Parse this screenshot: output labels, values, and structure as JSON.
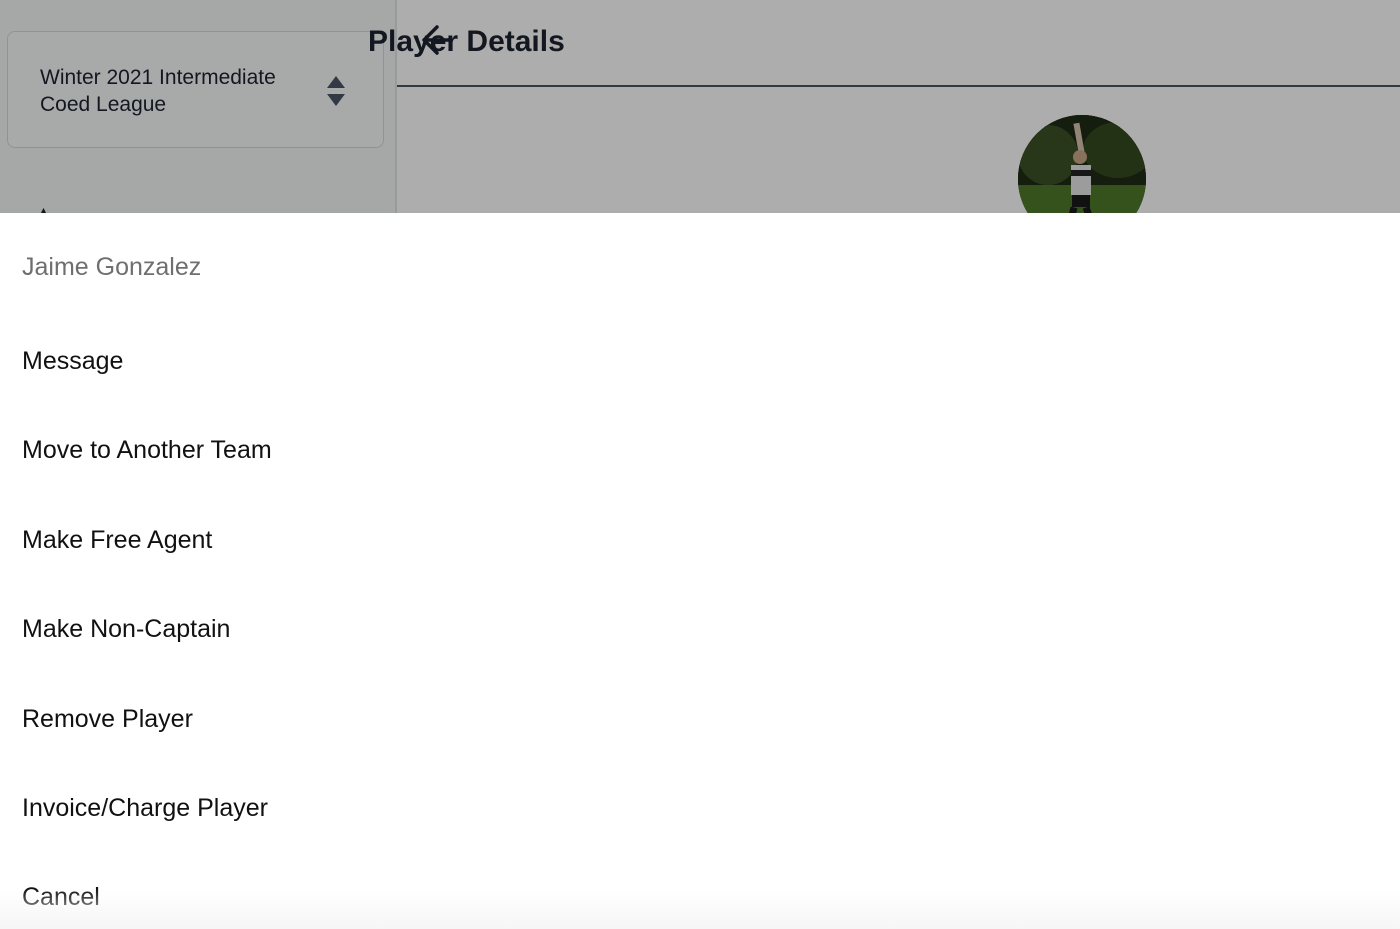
{
  "sidebar": {
    "league_select": {
      "label": "Winter 2021 Intermediate Coed League",
      "icon": "sort-updown-icon"
    }
  },
  "header": {
    "back_icon": "arrow-left-icon",
    "title": "Player Details"
  },
  "avatar": {
    "icon": "player-photo"
  },
  "action_sheet": {
    "header": "Jaime Gonzalez",
    "items": [
      {
        "label": "Message"
      },
      {
        "label": "Move to Another Team"
      },
      {
        "label": "Make Free Agent"
      },
      {
        "label": "Make Non-Captain"
      },
      {
        "label": "Remove Player"
      },
      {
        "label": "Invoice/Charge Player"
      },
      {
        "label": "Cancel"
      }
    ]
  },
  "colors": {
    "overlay": "#000000",
    "text_primary": "#111111",
    "text_secondary": "#6f6f6f",
    "header_title": "#1c2330"
  }
}
